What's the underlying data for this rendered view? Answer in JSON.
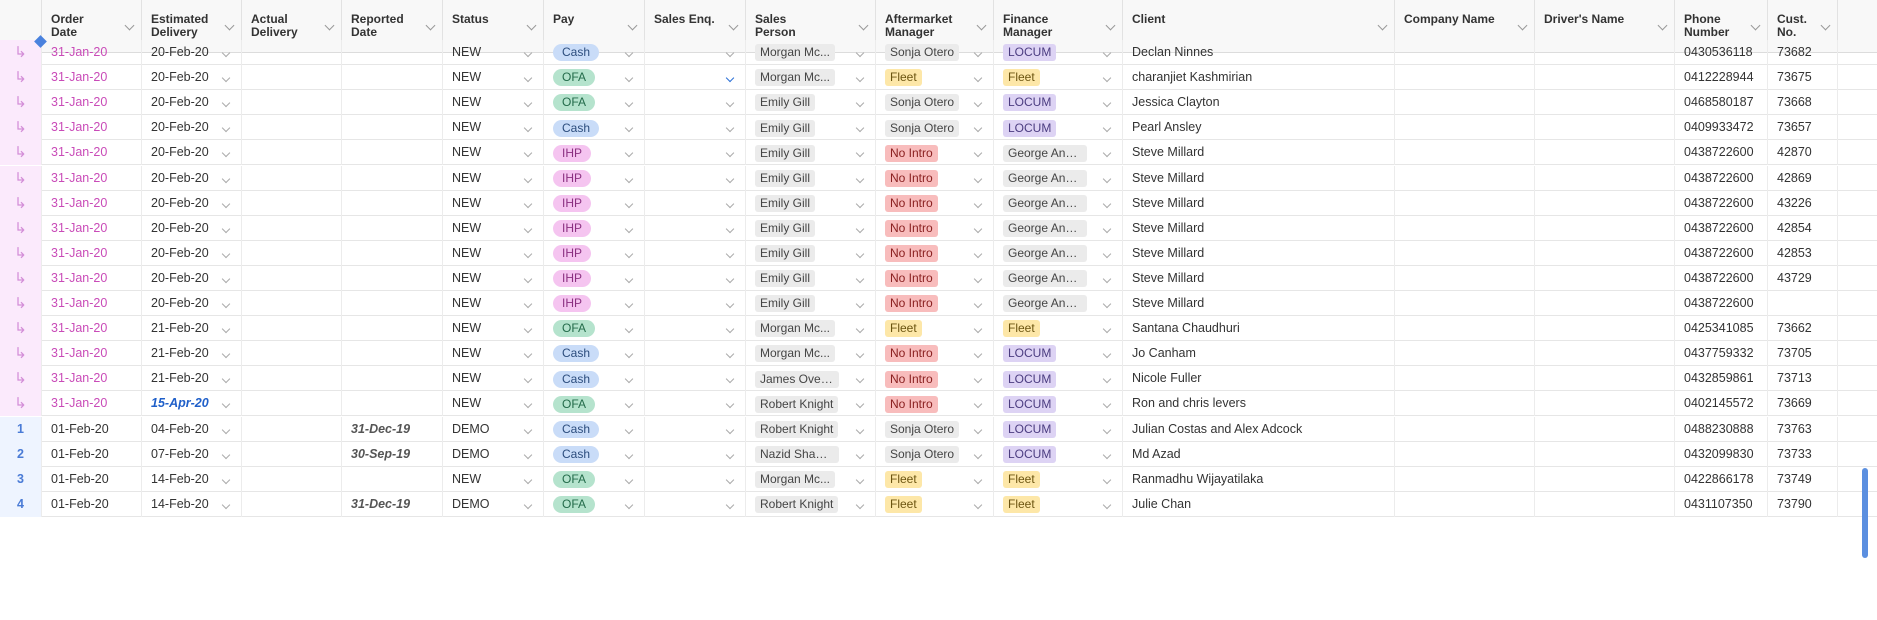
{
  "columns": [
    {
      "key": "idx",
      "label": ""
    },
    {
      "key": "order_date",
      "label": "Order\nDate"
    },
    {
      "key": "est_delivery",
      "label": "Estimated\nDelivery"
    },
    {
      "key": "actual_delivery",
      "label": "Actual\nDelivery"
    },
    {
      "key": "reported_date",
      "label": "Reported\nDate"
    },
    {
      "key": "status",
      "label": "Status"
    },
    {
      "key": "pay",
      "label": "Pay"
    },
    {
      "key": "sales_enq",
      "label": "Sales Enq."
    },
    {
      "key": "sales_person",
      "label": "Sales\nPerson"
    },
    {
      "key": "aftermarket",
      "label": "Aftermarket\nManager"
    },
    {
      "key": "finance",
      "label": "Finance\nManager"
    },
    {
      "key": "client",
      "label": "Client"
    },
    {
      "key": "company",
      "label": "Company Name"
    },
    {
      "key": "driver",
      "label": "Driver's Name"
    },
    {
      "key": "phone",
      "label": "Phone\nNumber"
    },
    {
      "key": "cust_no",
      "label": "Cust. No."
    }
  ],
  "colors": {
    "pay": {
      "Cash": {
        "bg": "#c9dcf8",
        "fg": "#2c4d7d"
      },
      "OFA": {
        "bg": "#b5e3cd",
        "fg": "#236b4a"
      },
      "IHP": {
        "bg": "#f5c4f0",
        "fg": "#8a2f80"
      }
    },
    "tags": {
      "Fleet": {
        "bg": "#fde7a8",
        "fg": "#6b5410"
      },
      "No Intro": {
        "bg": "#f8bcbc",
        "fg": "#8a2020"
      },
      "LOCUM": {
        "bg": "#ddd3f4",
        "fg": "#4b3c80"
      },
      "default": {
        "bg": "#ebebeb",
        "fg": "#444"
      }
    }
  },
  "rows": [
    {
      "idx": "↳",
      "order_date": "31-Jan-20",
      "est_delivery": "20-Feb-20",
      "actual_delivery": "",
      "reported_date": "",
      "status": "NEW",
      "pay": "Cash",
      "sales_enq": "",
      "sales_person": "Morgan Mc...",
      "aftermarket": "Sonja Otero",
      "finance": "LOCUM",
      "client": "Declan Ninnes",
      "company": "",
      "driver": "",
      "phone": "0430536118",
      "cust_no": "73682"
    },
    {
      "idx": "↳",
      "order_date": "31-Jan-20",
      "est_delivery": "20-Feb-20",
      "actual_delivery": "",
      "reported_date": "",
      "status": "NEW",
      "pay": "OFA",
      "sales_enq": "",
      "sales_enq_active": true,
      "sales_person": "Morgan Mc...",
      "aftermarket": "Fleet",
      "finance": "Fleet",
      "client": "charanjiet Kashmirian",
      "company": "",
      "driver": "",
      "phone": "0412228944",
      "cust_no": "73675"
    },
    {
      "idx": "↳",
      "order_date": "31-Jan-20",
      "est_delivery": "20-Feb-20",
      "actual_delivery": "",
      "reported_date": "",
      "status": "NEW",
      "pay": "OFA",
      "sales_enq": "",
      "sales_person": "Emily Gill",
      "aftermarket": "Sonja Otero",
      "finance": "LOCUM",
      "client": "Jessica Clayton",
      "company": "",
      "driver": "",
      "phone": "0468580187",
      "cust_no": "73668"
    },
    {
      "idx": "↳",
      "order_date": "31-Jan-20",
      "est_delivery": "20-Feb-20",
      "actual_delivery": "",
      "reported_date": "",
      "status": "NEW",
      "pay": "Cash",
      "sales_enq": "",
      "sales_person": "Emily Gill",
      "aftermarket": "Sonja Otero",
      "finance": "LOCUM",
      "client": "Pearl Ansley",
      "company": "",
      "driver": "",
      "phone": "0409933472",
      "cust_no": "73657"
    },
    {
      "idx": "↳",
      "order_date": "31-Jan-20",
      "est_delivery": "20-Feb-20",
      "actual_delivery": "",
      "reported_date": "",
      "status": "NEW",
      "pay": "IHP",
      "sales_enq": "",
      "sales_person": "Emily Gill",
      "aftermarket": "No Intro",
      "finance": "George Ana...",
      "client": "Steve Millard",
      "company": "",
      "driver": "",
      "phone": "0438722600",
      "cust_no": "42870"
    },
    {
      "idx": "↳",
      "order_date": "31-Jan-20",
      "est_delivery": "20-Feb-20",
      "actual_delivery": "",
      "reported_date": "",
      "status": "NEW",
      "pay": "IHP",
      "sales_enq": "",
      "sales_person": "Emily Gill",
      "aftermarket": "No Intro",
      "finance": "George Ana...",
      "client": "Steve Millard",
      "company": "",
      "driver": "",
      "phone": "0438722600",
      "cust_no": "42869"
    },
    {
      "idx": "↳",
      "order_date": "31-Jan-20",
      "est_delivery": "20-Feb-20",
      "actual_delivery": "",
      "reported_date": "",
      "status": "NEW",
      "pay": "IHP",
      "sales_enq": "",
      "sales_person": "Emily Gill",
      "aftermarket": "No Intro",
      "finance": "George Ana...",
      "client": "Steve Millard",
      "company": "",
      "driver": "",
      "phone": "0438722600",
      "cust_no": "43226"
    },
    {
      "idx": "↳",
      "order_date": "31-Jan-20",
      "est_delivery": "20-Feb-20",
      "actual_delivery": "",
      "reported_date": "",
      "status": "NEW",
      "pay": "IHP",
      "sales_enq": "",
      "sales_person": "Emily Gill",
      "aftermarket": "No Intro",
      "finance": "George Ana...",
      "client": "Steve Millard",
      "company": "",
      "driver": "",
      "phone": "0438722600",
      "cust_no": "42854"
    },
    {
      "idx": "↳",
      "order_date": "31-Jan-20",
      "est_delivery": "20-Feb-20",
      "actual_delivery": "",
      "reported_date": "",
      "status": "NEW",
      "pay": "IHP",
      "sales_enq": "",
      "sales_person": "Emily Gill",
      "aftermarket": "No Intro",
      "finance": "George Ana...",
      "client": "Steve Millard",
      "company": "",
      "driver": "",
      "phone": "0438722600",
      "cust_no": "42853"
    },
    {
      "idx": "↳",
      "order_date": "31-Jan-20",
      "est_delivery": "20-Feb-20",
      "actual_delivery": "",
      "reported_date": "",
      "status": "NEW",
      "pay": "IHP",
      "sales_enq": "",
      "sales_person": "Emily Gill",
      "aftermarket": "No Intro",
      "finance": "George Ana...",
      "client": "Steve Millard",
      "company": "",
      "driver": "",
      "phone": "0438722600",
      "cust_no": "43729"
    },
    {
      "idx": "↳",
      "order_date": "31-Jan-20",
      "est_delivery": "20-Feb-20",
      "actual_delivery": "",
      "reported_date": "",
      "status": "NEW",
      "pay": "IHP",
      "sales_enq": "",
      "sales_person": "Emily Gill",
      "aftermarket": "No Intro",
      "finance": "George Ana...",
      "client": "Steve Millard",
      "company": "",
      "driver": "",
      "phone": "0438722600",
      "cust_no": ""
    },
    {
      "idx": "↳",
      "order_date": "31-Jan-20",
      "est_delivery": "21-Feb-20",
      "actual_delivery": "",
      "reported_date": "",
      "status": "NEW",
      "pay": "OFA",
      "sales_enq": "",
      "sales_person": "Morgan Mc...",
      "aftermarket": "Fleet",
      "finance": "Fleet",
      "client": "Santana Chaudhuri",
      "company": "",
      "driver": "",
      "phone": "0425341085",
      "cust_no": "73662"
    },
    {
      "idx": "↳",
      "order_date": "31-Jan-20",
      "est_delivery": "21-Feb-20",
      "actual_delivery": "",
      "reported_date": "",
      "status": "NEW",
      "pay": "Cash",
      "sales_enq": "",
      "sales_person": "Morgan Mc...",
      "aftermarket": "No Intro",
      "finance": "LOCUM",
      "client": "Jo Canham",
      "company": "",
      "driver": "",
      "phone": "0437759332",
      "cust_no": "73705"
    },
    {
      "idx": "↳",
      "order_date": "31-Jan-20",
      "est_delivery": "21-Feb-20",
      "actual_delivery": "",
      "reported_date": "",
      "status": "NEW",
      "pay": "Cash",
      "sales_enq": "",
      "sales_person": "James Over...",
      "aftermarket": "No Intro",
      "finance": "LOCUM",
      "client": "Nicole Fuller",
      "company": "",
      "driver": "",
      "phone": "0432859861",
      "cust_no": "73713"
    },
    {
      "idx": "↳",
      "order_date": "31-Jan-20",
      "est_delivery": "15-Apr-20",
      "est_style": "blue",
      "actual_delivery": "",
      "reported_date": "",
      "status": "NEW",
      "pay": "OFA",
      "sales_enq": "",
      "sales_person": "Robert Knight",
      "aftermarket": "No Intro",
      "finance": "LOCUM",
      "client": "Ron and chris levers",
      "company": "",
      "driver": "",
      "phone": "0402145572",
      "cust_no": "73669"
    },
    {
      "idx": "1",
      "order_date": "01-Feb-20",
      "est_delivery": "04-Feb-20",
      "actual_delivery": "",
      "reported_date": "31-Dec-19",
      "status": "DEMO",
      "pay": "Cash",
      "sales_enq": "",
      "sales_person": "Robert Knight",
      "aftermarket": "Sonja Otero",
      "finance": "LOCUM",
      "client": "Julian Costas and Alex Adcock",
      "company": "",
      "driver": "",
      "phone": "0488230888",
      "cust_no": "73763"
    },
    {
      "idx": "2",
      "order_date": "01-Feb-20",
      "est_delivery": "07-Feb-20",
      "actual_delivery": "",
      "reported_date": "30-Sep-19",
      "status": "DEMO",
      "pay": "Cash",
      "sales_enq": "",
      "sales_person": "Nazid Sham...",
      "aftermarket": "Sonja Otero",
      "finance": "LOCUM",
      "client": "Md Azad",
      "company": "",
      "driver": "",
      "phone": "0432099830",
      "cust_no": "73733"
    },
    {
      "idx": "3",
      "order_date": "01-Feb-20",
      "est_delivery": "14-Feb-20",
      "actual_delivery": "",
      "reported_date": "",
      "status": "NEW",
      "pay": "OFA",
      "sales_enq": "",
      "sales_person": "Morgan Mc...",
      "aftermarket": "Fleet",
      "finance": "Fleet",
      "client": "Ranmadhu Wijayatilaka",
      "company": "",
      "driver": "",
      "phone": "0422866178",
      "cust_no": "73749"
    },
    {
      "idx": "4",
      "order_date": "01-Feb-20",
      "est_delivery": "14-Feb-20",
      "actual_delivery": "",
      "reported_date": "31-Dec-19",
      "status": "DEMO",
      "pay": "OFA",
      "sales_enq": "",
      "sales_person": "Robert Knight",
      "aftermarket": "Fleet",
      "finance": "Fleet",
      "client": "Julie Chan",
      "company": "",
      "driver": "",
      "phone": "0431107350",
      "cust_no": "73790"
    }
  ]
}
